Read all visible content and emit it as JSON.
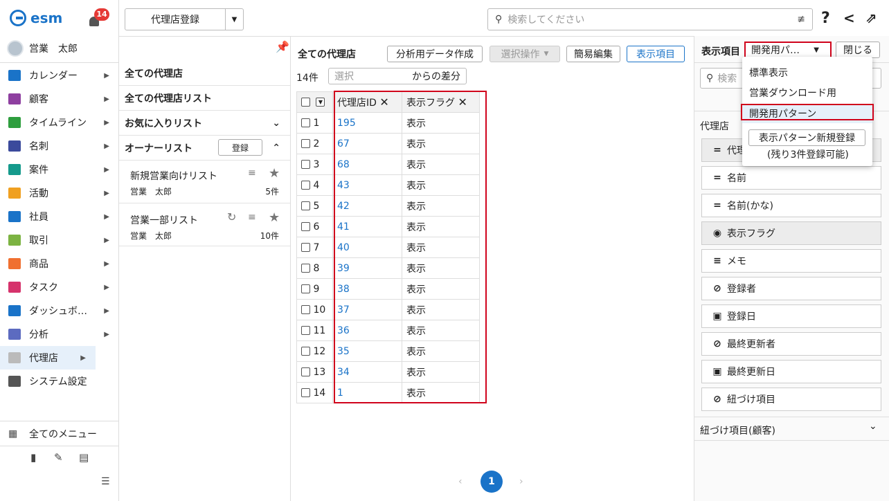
{
  "app": {
    "logo": "esm",
    "notification_count": "14",
    "user_name": "営業　太郎"
  },
  "nav": {
    "items": [
      {
        "label": "カレンダー",
        "icon": "calendar-icon",
        "color": "#1a73c8"
      },
      {
        "label": "顧客",
        "icon": "building-icon",
        "color": "#8e3fa0"
      },
      {
        "label": "タイムライン",
        "icon": "chat-icon",
        "color": "#2e9e3e"
      },
      {
        "label": "名刺",
        "icon": "card-icon",
        "color": "#3b4a9c"
      },
      {
        "label": "案件",
        "icon": "folder-icon",
        "color": "#159a8c"
      },
      {
        "label": "活動",
        "icon": "clipboard-icon",
        "color": "#f0a020"
      },
      {
        "label": "社員",
        "icon": "person-icon",
        "color": "#1a73c8"
      },
      {
        "label": "取引",
        "icon": "ledger-icon",
        "color": "#7cb342"
      },
      {
        "label": "商品",
        "icon": "box-icon",
        "color": "#f07030"
      },
      {
        "label": "タスク",
        "icon": "check-icon",
        "color": "#d6336c"
      },
      {
        "label": "ダッシュボ…",
        "icon": "dashboard-icon",
        "color": "#1a73c8"
      },
      {
        "label": "分析",
        "icon": "chart-icon",
        "color": "#5c6bc0"
      },
      {
        "label": "代理店",
        "icon": "document-icon",
        "color": "#bbbbbb"
      },
      {
        "label": "システム設定",
        "icon": "gear-icon",
        "color": "#555555"
      }
    ],
    "all_menu": "全てのメニュー"
  },
  "topbar": {
    "register_button": "代理店登録",
    "search_placeholder": "検索してください"
  },
  "lists": {
    "all": "全ての代理店",
    "all_list": "全ての代理店リスト",
    "favorites": "お気に入りリスト",
    "owner": "オーナーリスト",
    "register": "登録",
    "cards": [
      {
        "title": "新規営業向けリスト",
        "owner": "営業　太郎",
        "count": "5件"
      },
      {
        "title": "営業一部リスト",
        "owner": "営業　太郎",
        "count": "10件"
      }
    ]
  },
  "main": {
    "title": "全ての代理店",
    "analysis_btn": "分析用データ作成",
    "select_op_btn": "選択操作",
    "quick_edit_btn": "簡易編集",
    "display_items_btn": "表示項目",
    "count": "14件",
    "select_placeholder": "選択",
    "diff_label": "からの差分",
    "col_id": "代理店ID",
    "col_flag": "表示フラグ",
    "rows": [
      {
        "n": "1",
        "id": "195",
        "flag": "表示"
      },
      {
        "n": "2",
        "id": "67",
        "flag": "表示"
      },
      {
        "n": "3",
        "id": "68",
        "flag": "表示"
      },
      {
        "n": "4",
        "id": "43",
        "flag": "表示"
      },
      {
        "n": "5",
        "id": "42",
        "flag": "表示"
      },
      {
        "n": "6",
        "id": "41",
        "flag": "表示"
      },
      {
        "n": "7",
        "id": "40",
        "flag": "表示"
      },
      {
        "n": "8",
        "id": "39",
        "flag": "表示"
      },
      {
        "n": "9",
        "id": "38",
        "flag": "表示"
      },
      {
        "n": "10",
        "id": "37",
        "flag": "表示"
      },
      {
        "n": "11",
        "id": "36",
        "flag": "表示"
      },
      {
        "n": "12",
        "id": "35",
        "flag": "表示"
      },
      {
        "n": "13",
        "id": "34",
        "flag": "表示"
      },
      {
        "n": "14",
        "id": "1",
        "flag": "表示"
      }
    ],
    "page": "1"
  },
  "right": {
    "title": "表示項目",
    "pattern_select": "開発用パ…",
    "close": "閉じる",
    "search_placeholder": "検索",
    "section": "代理店",
    "fields": [
      {
        "label": "代理",
        "icon": "="
      },
      {
        "label": "名前",
        "icon": "="
      },
      {
        "label": "名前(かな)",
        "icon": "="
      },
      {
        "label": "表示フラグ",
        "icon": "◉"
      },
      {
        "label": "メモ",
        "icon": "≡"
      },
      {
        "label": "登録者",
        "icon": "⊘"
      },
      {
        "label": "登録日",
        "icon": "▣"
      },
      {
        "label": "最終更新者",
        "icon": "⊘"
      },
      {
        "label": "最終更新日",
        "icon": "▣"
      },
      {
        "label": "紐づけ項目",
        "icon": "⊘"
      }
    ],
    "linked_section": "紐づけ項目(顧客)",
    "popup": {
      "items": [
        "標準表示",
        "営業ダウンロード用",
        "開発用パターン"
      ],
      "new_button": "表示パターン新規登録",
      "remaining": "(残り3件登録可能)"
    }
  }
}
